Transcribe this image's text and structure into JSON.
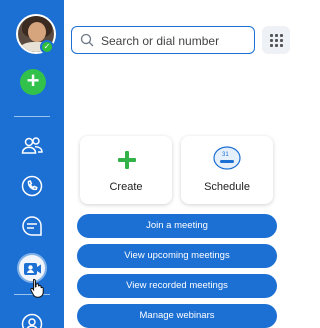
{
  "sidebar": {
    "presence_check": "✓",
    "add_label": "+"
  },
  "search": {
    "placeholder": "Search or dial number"
  },
  "cards": {
    "create_label": "Create",
    "schedule_label": "Schedule",
    "calendar_day": "31"
  },
  "actions": [
    {
      "label": "Join a meeting"
    },
    {
      "label": "View upcoming meetings"
    },
    {
      "label": "View recorded meetings"
    },
    {
      "label": "Manage webinars"
    }
  ],
  "colors": {
    "brand": "#1c6fd3",
    "accent_green": "#32c14a"
  }
}
